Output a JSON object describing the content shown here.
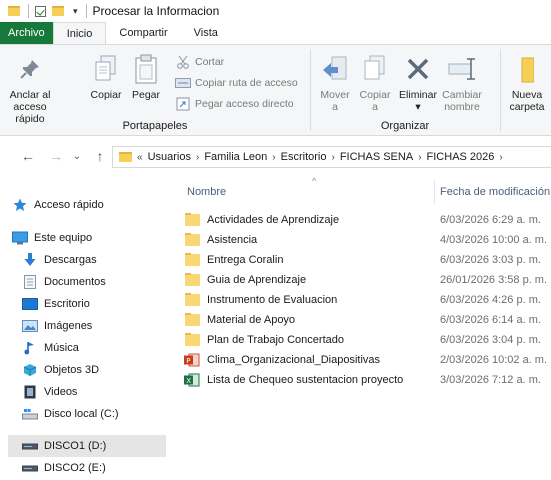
{
  "window": {
    "title": "Procesar la Informacion"
  },
  "tabs": [
    "Archivo",
    "Inicio",
    "Compartir",
    "Vista"
  ],
  "ribbon": {
    "pin_label_1": "Anclar al",
    "pin_label_2": "acceso rápido",
    "copy": "Copiar",
    "paste": "Pegar",
    "cut": "Cortar",
    "copy_path": "Copiar ruta de acceso",
    "paste_shortcut": "Pegar acceso directo",
    "portapapeles": "Portapapeles",
    "move_1": "Mover",
    "move_2": "a",
    "copyto_1": "Copiar",
    "copyto_2": "a",
    "delete_1": "Eliminar",
    "rename_1": "Cambiar",
    "rename_2": "nombre",
    "organizar": "Organizar",
    "new_1": "Nueva",
    "new_2": "carpeta"
  },
  "address": {
    "prefix": "«",
    "crumbs": [
      "Usuarios",
      "Familia Leon",
      "Escritorio",
      "FICHAS SENA",
      "FICHAS 2026"
    ]
  },
  "nav": {
    "items": [
      "Acceso rápido",
      "Este equipo",
      "Descargas",
      "Documentos",
      "Escritorio",
      "Imágenes",
      "Música",
      "Objetos 3D",
      "Videos",
      "Disco local (C:)",
      "DISCO1 (D:)",
      "DISCO2 (E:)"
    ]
  },
  "columns": {
    "name": "Nombre",
    "date": "Fecha de modificación"
  },
  "files": [
    {
      "name": "Actividades de Aprendizaje",
      "date": "6/03/2026 6:29 a. m.",
      "type": "folder"
    },
    {
      "name": "Asistencia",
      "date": "4/03/2026 10:00 a. m.",
      "type": "folder"
    },
    {
      "name": "Entrega Coralin",
      "date": "6/03/2026 3:03 p. m.",
      "type": "folder"
    },
    {
      "name": "Guia de Aprendizaje",
      "date": "26/01/2026 3:58 p. m.",
      "type": "folder"
    },
    {
      "name": "Instrumento de Evaluacion",
      "date": "6/03/2026 4:26 p. m.",
      "type": "folder"
    },
    {
      "name": "Material de Apoyo",
      "date": "6/03/2026 6:14 a. m.",
      "type": "folder"
    },
    {
      "name": "Plan de Trabajo Concertado",
      "date": "6/03/2026 3:04 p. m.",
      "type": "folder"
    },
    {
      "name": "Clima_Organizacional_Diapositivas",
      "date": "2/03/2026 10:02 a. m.",
      "type": "pptx"
    },
    {
      "name": "Lista de Chequeo sustentacion proyecto",
      "date": "3/03/2026 7:12 a. m.",
      "type": "xlsx"
    }
  ]
}
